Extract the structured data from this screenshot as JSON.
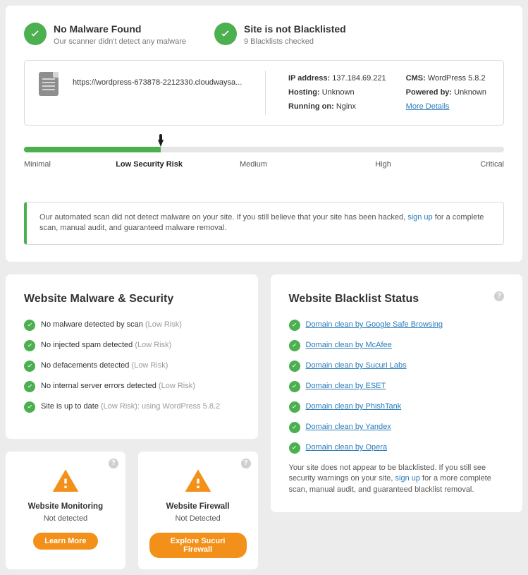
{
  "status": {
    "malware": {
      "title": "No Malware Found",
      "sub": "Our scanner didn't detect any malware"
    },
    "blacklist": {
      "title": "Site is not Blacklisted",
      "sub": "9 Blacklists checked"
    }
  },
  "details": {
    "url": "https://wordpress-673878-2212330.cloudwaysa...",
    "ip_label": "IP address:",
    "ip": "137.184.69.221",
    "hosting_label": "Hosting:",
    "hosting": "Unknown",
    "running_label": "Running on:",
    "running": "Nginx",
    "cms_label": "CMS:",
    "cms": "WordPress 5.8.2",
    "powered_label": "Powered by:",
    "powered": "Unknown",
    "more_details": "More Details"
  },
  "risk": {
    "levels": [
      "Minimal",
      "Low Security Risk",
      "Medium",
      "High",
      "Critical"
    ]
  },
  "notice": {
    "pre": "Our automated scan did not detect malware on your site. If you still believe that your site has been hacked, ",
    "link": "sign up",
    "post": " for a complete scan, manual audit, and guaranteed malware removal."
  },
  "malware_section": {
    "title": "Website Malware & Security",
    "items": [
      {
        "text": "No malware detected by scan",
        "note": "(Low Risk)"
      },
      {
        "text": "No injected spam detected",
        "note": "(Low Risk)"
      },
      {
        "text": "No defacements detected",
        "note": "(Low Risk)"
      },
      {
        "text": "No internal server errors detected",
        "note": "(Low Risk)"
      },
      {
        "text": "Site is up to date",
        "note": "(Low Risk): using WordPress 5.8.2"
      }
    ]
  },
  "blacklist_section": {
    "title": "Website Blacklist Status",
    "items": [
      "Domain clean by Google Safe Browsing",
      "Domain clean by McAfee",
      "Domain clean by Sucuri Labs",
      "Domain clean by ESET",
      "Domain clean by PhishTank",
      "Domain clean by Yandex",
      "Domain clean by Opera"
    ],
    "note_pre": "Your site does not appear to be blacklisted. If you still see security warnings on your site, ",
    "note_link": "sign up",
    "note_post": " for a more complete scan, manual audit, and guaranteed blacklist removal."
  },
  "monitoring": {
    "title": "Website Monitoring",
    "sub": "Not detected",
    "btn": "Learn More"
  },
  "firewall": {
    "title": "Website Firewall",
    "sub": "Not Detected",
    "btn": "Explore Sucuri Firewall"
  }
}
